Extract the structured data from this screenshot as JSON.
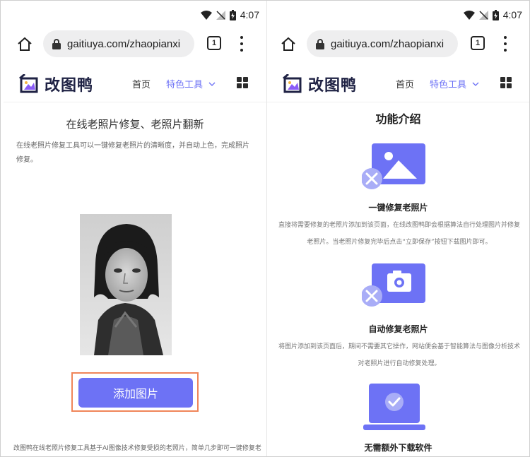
{
  "status": {
    "time": "4:07"
  },
  "browser": {
    "url": "gaitiuya.com/zhaopianxi",
    "tab_count": "1"
  },
  "site": {
    "logo_text": "改图鸭",
    "nav_home": "首页",
    "nav_tools": "特色工具"
  },
  "left": {
    "title": "在线老照片修复、老照片翻新",
    "description": "在线老照片修复工具可以一键修复老照片的清晰度，并自动上色，完成照片修复。",
    "add_button": "添加图片",
    "footer_text": "改图鸭在线老照片修复工具基于AI图像技术修复受损的老照片，简单几步即可一键修复老"
  },
  "right": {
    "section_title": "功能介绍",
    "features": [
      {
        "name": "一键修复老照片",
        "desc": "直接将需要修复的老照片添加到该页面，在线改图鸭即会根据算法自行处理图片并修复老照片。当老照片修复完毕后点击“立即保存”按钮下载图片即可。",
        "icon": "image-repair-icon"
      },
      {
        "name": "自动修复老照片",
        "desc": "将图片添加到该页面后，期间不需要其它操作，网站便会基于智能算法与图像分析技术对老照片进行自动修复处理。",
        "icon": "camera-repair-icon"
      },
      {
        "name": "无需额外下载软件",
        "desc": "",
        "icon": "laptop-check-icon"
      }
    ]
  },
  "colors": {
    "accent": "#6d72f5",
    "highlight_border": "#f08559"
  }
}
